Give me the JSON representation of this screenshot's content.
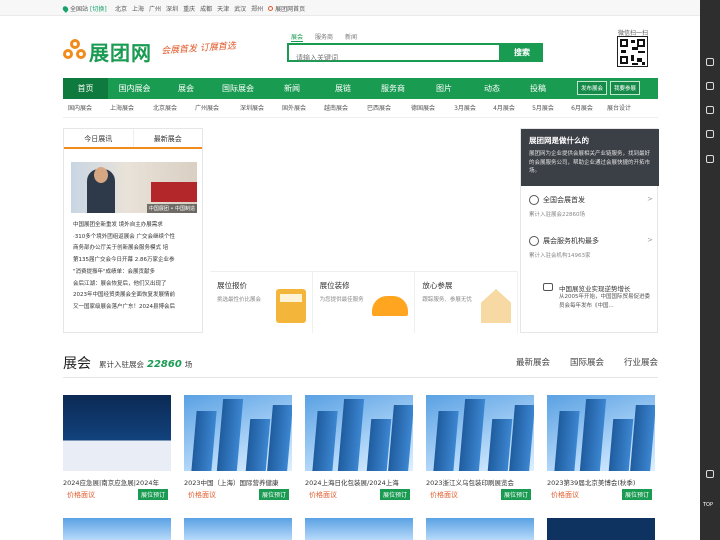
{
  "topbar": {
    "location": "全国站",
    "switch": "[切换]",
    "cities": [
      "北京",
      "上海",
      "广州",
      "深圳",
      "重庆",
      "成都",
      "天津",
      "武汉",
      "郑州"
    ],
    "home_link": "展团网首页"
  },
  "brand": {
    "name": "展团网",
    "slogan": "会展首发 订展首选",
    "logo_color": "#1a9b52",
    "accent": "#f08b1c"
  },
  "search": {
    "tabs": [
      "展会",
      "服务商",
      "新闻"
    ],
    "placeholder": "请输入关键词",
    "button": "搜索"
  },
  "qr": {
    "title": "微信扫一扫"
  },
  "nav": {
    "items": [
      "首页",
      "国内展会",
      "展会",
      "国际展会",
      "新闻",
      "展链",
      "服务商",
      "图片",
      "动态",
      "投稿"
    ],
    "publish": "发布展会",
    "participate": "我要参展"
  },
  "subnav": [
    "国内展会",
    "上海展会",
    "北京展会",
    "广州展会",
    "深圳展会",
    "国外展会",
    "越南展会",
    "巴西展会",
    "德国展会",
    "3月展会",
    "4月展会",
    "5月展会",
    "6月展会",
    "展台设计"
  ],
  "left_panel": {
    "tabs": [
      "今日展讯",
      "最新展会"
    ],
    "image_caption": "中国展团 • 中国制造",
    "news": [
      "中国展团全新重发 境外自主办展需求",
      "·310多个境外团组返展会 广交会继续个性",
      "商务部办公厅关于创新展会服务模式 培",
      "第135届广交会今日开幕 2.86万家企业参",
      "\"消费提振年\"成绩单：会展贡献多",
      "会后江湖：展会恢复后，他们又出现了",
      "2023年中国经贸类展会全面恢复发展情前",
      "又一国家级展会落户广东！2024县博会后"
    ]
  },
  "services": [
    {
      "title": "展位报价",
      "desc": "挑选最性价比展会"
    },
    {
      "title": "展位装修",
      "desc": "为您提供最佳服务"
    },
    {
      "title": "放心参展",
      "desc": "跟踪服务、参展无忧"
    }
  ],
  "right_panel": {
    "title": "展团网是做什么的",
    "desc": "展团网为企业提供会展相关产业链服务，找到最好的会展服务公司，帮助企业通过会展快捷的开拓市场。",
    "items": [
      {
        "title": "全国会展首发",
        "desc": "累计入驻展会22860场"
      },
      {
        "title": "展会服务机构最多",
        "desc": "累计入驻会机构14963家"
      }
    ],
    "trend_title": "中国展览业实现逆势增长",
    "trend_desc": "从2005年开始，中国国际贸易促进委员会每年发布《中国..."
  },
  "section": {
    "title": "展会",
    "subtitle_pre": "累计入驻展会",
    "count": "22860",
    "unit": "场",
    "tabs": [
      "最新展会",
      "国际展会",
      "行业展会"
    ]
  },
  "exhibitions": [
    {
      "title": "2024应急展|南京应急展|2024年",
      "price": "价格面议",
      "book": "展位预订"
    },
    {
      "title": "2023中国（上海）国际营养健康",
      "price": "价格面议",
      "book": "展位预订"
    },
    {
      "title": "2024上海日化包装展/2024上海",
      "price": "价格面议",
      "book": "展位预订"
    },
    {
      "title": "2023浙江义乌包装印刷展览会",
      "price": "价格面议",
      "book": "展位预订"
    },
    {
      "title": "2023第39届北京美博会(秋季)",
      "price": "价格面议",
      "book": "展位预订"
    }
  ],
  "rail": {
    "top_label": "TOP"
  }
}
